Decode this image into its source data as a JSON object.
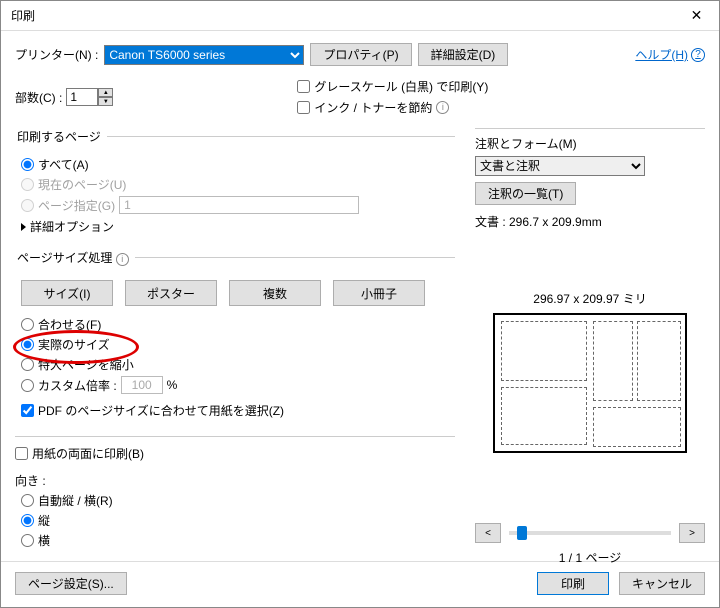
{
  "window": {
    "title": "印刷"
  },
  "top": {
    "printer_label": "プリンター(N) :",
    "printer_selected": "Canon TS6000 series",
    "properties_btn": "プロパティ(P)",
    "advanced_btn": "詳細設定(D)",
    "help_label": "ヘルプ(H)"
  },
  "copies": {
    "label": "部数(C) :",
    "value": "1"
  },
  "options": {
    "grayscale": "グレースケール (白黒) で印刷(Y)",
    "savetoner": "インク / トナーを節約"
  },
  "pagerange": {
    "legend": "印刷するページ",
    "all": "すべて(A)",
    "current": "現在のページ(U)",
    "pages": "ページ指定(G)",
    "pages_placeholder": "1",
    "more": "詳細オプション"
  },
  "sizing": {
    "legend": "ページサイズ処理",
    "size": "サイズ(I)",
    "poster": "ポスター",
    "multi": "複数",
    "booklet": "小冊子",
    "fit": "合わせる(F)",
    "actual": "実際のサイズ",
    "shrink": "特大ページを縮小",
    "custom": "カスタム倍率 :",
    "custom_val": "100",
    "percent": "%",
    "choosepaper": "PDF のページサイズに合わせて用紙を選択(Z)"
  },
  "duplex": {
    "label": "用紙の両面に印刷(B)"
  },
  "orient": {
    "legend": "向き :",
    "auto": "自動縦 / 横(R)",
    "portrait": "縦",
    "landscape": "横"
  },
  "annots": {
    "legend": "注釈とフォーム(M)",
    "selected": "文書と注釈",
    "list_btn": "注釈の一覧(T)"
  },
  "preview": {
    "docsize": "文書 : 296.7 x 209.9mm",
    "dim": "296.97 x 209.97 ミリ",
    "pagenum": "1 / 1 ページ",
    "prev": "<",
    "next": ">"
  },
  "footer": {
    "pagesetup": "ページ設定(S)...",
    "print": "印刷",
    "cancel": "キャンセル"
  }
}
